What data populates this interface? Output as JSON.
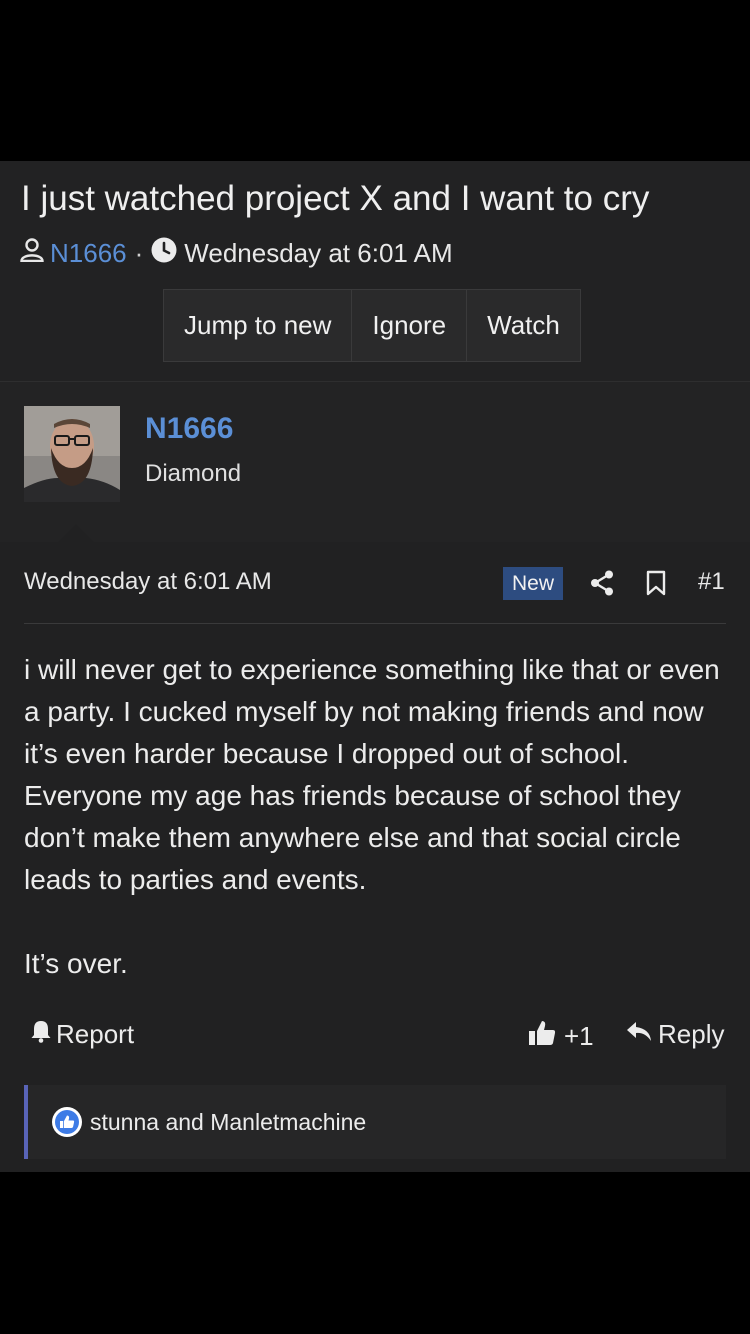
{
  "thread": {
    "title": "I just watched project X and I want to cry",
    "author": "N1666",
    "separator": "·",
    "date": "Wednesday at 6:01 AM"
  },
  "buttons": {
    "jump_to_new": "Jump to new",
    "ignore": "Ignore",
    "watch": "Watch"
  },
  "post": {
    "username": "N1666",
    "user_title": "Diamond",
    "date": "Wednesday at 6:01 AM",
    "badge": "New",
    "number": "#1",
    "paragraph1": "i will never get to experience something like that or even a party. I cucked myself by not making friends and now it’s even harder because I dropped out of school. Everyone my age has friends because of school they don’t make them anywhere else and that social circle leads to parties and events.",
    "paragraph2": "It’s over."
  },
  "actions": {
    "report": "Report",
    "like_count": "+1",
    "reply": "Reply"
  },
  "reactions": {
    "text": "stunna and Manletmachine"
  },
  "colors": {
    "accent": "#5b8fd6",
    "badge": "#2d4c80",
    "reaction_bar": "#5964b8",
    "background": "#212122"
  },
  "icons": [
    "user-icon",
    "clock-icon",
    "share-icon",
    "bookmark-icon",
    "bell-icon",
    "thumbs-up-icon",
    "reply-arrow-icon",
    "like-reaction-icon"
  ]
}
